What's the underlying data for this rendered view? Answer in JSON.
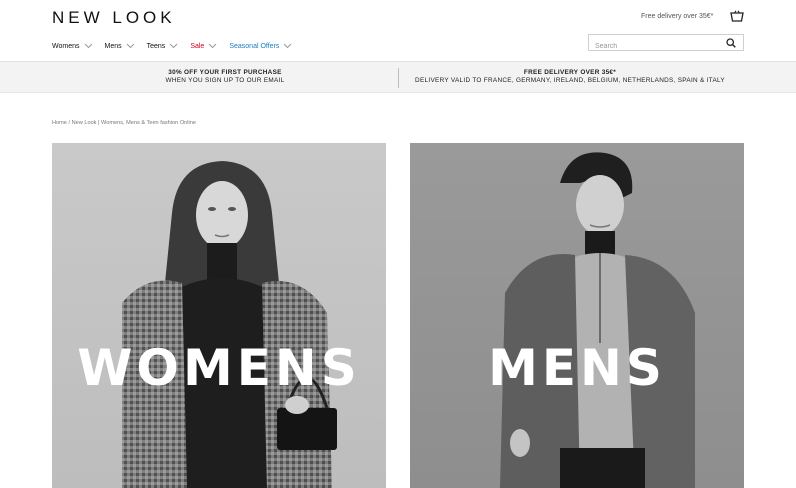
{
  "header": {
    "logo": "NEW LOOK",
    "delivery_text": "Free delivery over 35€*",
    "basket_icon": "basket-icon",
    "nav": [
      {
        "label": "Womens"
      },
      {
        "label": "Mens"
      },
      {
        "label": "Teens"
      },
      {
        "label": "Sale"
      },
      {
        "label": "Seasonal Offers"
      }
    ],
    "search_placeholder": "Search",
    "search_icon": "search-icon"
  },
  "promo": {
    "left_title": "30% OFF YOUR FIRST PURCHASE",
    "left_sub": "WHEN YOU SIGN UP TO OUR EMAIL",
    "right_title": "FREE DELIVERY OVER 35€*",
    "right_sub": "DELIVERY VALID TO FRANCE, GERMANY, IRELAND, BELGIUM, NETHERLANDS, SPAIN & ITALY"
  },
  "breadcrumb": {
    "home": "Home",
    "separator": "/",
    "current": "New Look | Womens, Mens & Teen fashion Online"
  },
  "tiles": {
    "women": "WOMENS",
    "men": "MENS"
  },
  "colors": {
    "sale": "#d0021b",
    "seasonal": "#1c7cc2",
    "promo_bg": "#f3f3f3"
  }
}
